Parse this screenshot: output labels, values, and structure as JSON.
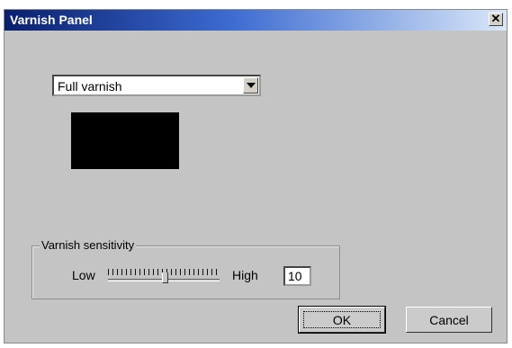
{
  "window": {
    "title": "Varnish Panel",
    "close_glyph": "✕"
  },
  "varnish_dropdown": {
    "selected": "Full varnish"
  },
  "preview": {
    "color": "#000000"
  },
  "sensitivity": {
    "legend": "Varnish sensitivity",
    "low_label": "Low",
    "high_label": "High",
    "value": "10",
    "slider_fraction": 0.5
  },
  "buttons": {
    "ok": "OK",
    "cancel": "Cancel"
  }
}
